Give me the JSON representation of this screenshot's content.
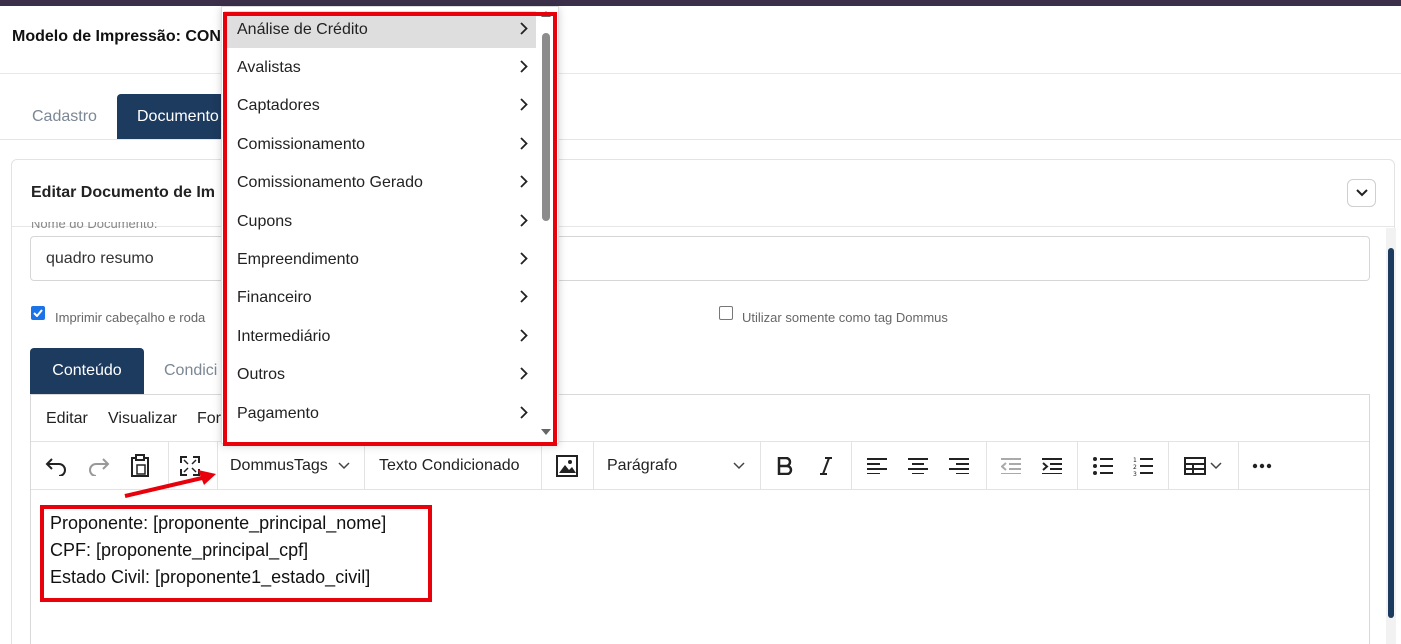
{
  "header": {
    "page_title": "Modelo de Impressão: CON"
  },
  "tabs": [
    {
      "label": "Cadastro"
    },
    {
      "label": "Documento"
    }
  ],
  "card": {
    "title": "Editar Documento de Im"
  },
  "form": {
    "name_label": "Nome do Documento:",
    "name_value": "quadro resumo",
    "checkbox_print_header": {
      "label": "Imprimir cabeçalho e roda",
      "checked": true
    },
    "checkbox_dommus_tag": {
      "label": "Utilizar somente como tag Dommus",
      "checked": false
    }
  },
  "content_tabs": [
    {
      "label": "Conteúdo"
    },
    {
      "label": "Condici"
    }
  ],
  "editor": {
    "menubar": [
      "Editar",
      "Visualizar",
      "For"
    ],
    "toolbar": {
      "dommus_tags": "DommusTags",
      "texto_condicionado": "Texto Condicionado",
      "block_format": "Parágrafo"
    },
    "content_lines": [
      "Proponente: [proponente_principal_nome]",
      "CPF: [proponente_principal_cpf]",
      "Estado Civil: [proponente1_estado_civil]"
    ]
  },
  "dropdown": {
    "items": [
      {
        "label": "Análise de Crédito",
        "active": true
      },
      {
        "label": "Avalistas"
      },
      {
        "label": "Captadores"
      },
      {
        "label": "Comissionamento"
      },
      {
        "label": "Comissionamento Gerado"
      },
      {
        "label": "Cupons"
      },
      {
        "label": "Empreendimento"
      },
      {
        "label": "Financeiro"
      },
      {
        "label": "Intermediário"
      },
      {
        "label": "Outros"
      },
      {
        "label": "Pagamento"
      }
    ]
  },
  "colors": {
    "primary": "#1d3a5f",
    "highlight": "#e8000a",
    "checkbox": "#1a73e8"
  }
}
